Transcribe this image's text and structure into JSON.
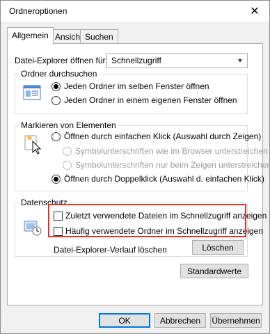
{
  "window": {
    "title": "Ordneroptionen",
    "close_glyph": "✕"
  },
  "tabs": [
    {
      "label": "Allgemein",
      "active": true
    },
    {
      "label": "Ansicht",
      "active": false
    },
    {
      "label": "Suchen",
      "active": false
    }
  ],
  "open_in": {
    "label": "Datei-Explorer öffnen für:",
    "value": "Schnellzugriff"
  },
  "browse": {
    "legend": "Ordner durchsuchen",
    "icon": "window-layout-icon",
    "options": [
      {
        "label": "Jeden Ordner im selben Fenster öffnen",
        "checked": true,
        "enabled": true
      },
      {
        "label": "Jeden Ordner in einem eigenen Fenster öffnen",
        "checked": false,
        "enabled": true
      }
    ]
  },
  "click": {
    "legend": "Markieren von Elementen",
    "icon": "pointer-click-icon",
    "options": [
      {
        "label": "Öffnen durch einfachen Klick (Auswahl durch Zeigen)",
        "checked": false,
        "enabled": true
      },
      {
        "label": "Symbolunterschriften wie im Browser unterstreichen",
        "checked": false,
        "enabled": false
      },
      {
        "label": "Symbolunterschriften nur beim Zeigen unterstreichen",
        "checked": false,
        "enabled": false
      },
      {
        "label": "Öffnen durch Doppelklick (Auswahl d. einfachen Klick)",
        "checked": true,
        "enabled": true
      }
    ]
  },
  "privacy": {
    "legend": "Datenschutz",
    "icon": "privacy-shield-icon",
    "checks": [
      {
        "label": "Zuletzt verwendete Dateien im Schnellzugriff anzeigen",
        "checked": false
      },
      {
        "label": "Häufig verwendete Ordner im Schnellzugriff anzeigen",
        "checked": false
      }
    ],
    "history_label": "Datei-Explorer-Verlauf löschen",
    "clear_button": "Löschen",
    "highlight_color": "#e0312c"
  },
  "defaults_button": "Standardwerte",
  "footer": {
    "ok": "OK",
    "cancel": "Abbrechen",
    "apply": "Übernehmen"
  }
}
